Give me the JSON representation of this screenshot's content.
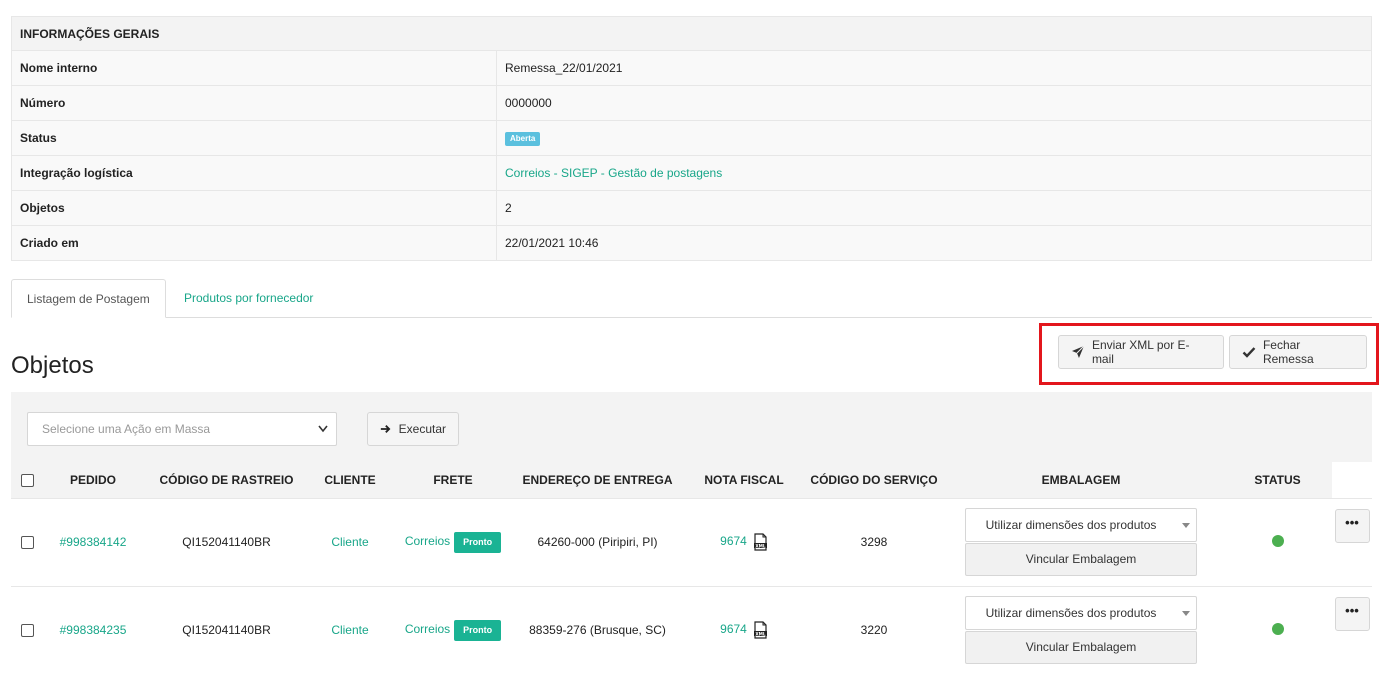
{
  "info": {
    "heading": "INFORMAÇÕES GERAIS",
    "rows": [
      {
        "label": "Nome interno",
        "value": "Remessa_22/01/2021"
      },
      {
        "label": "Número",
        "value": "0000000"
      },
      {
        "label": "Status",
        "value": "Aberta"
      },
      {
        "label": "Integração logística",
        "value": "Correios - SIGEP - Gestão de postagens"
      },
      {
        "label": "Objetos",
        "value": "2"
      },
      {
        "label": "Criado em",
        "value": "22/01/2021 10:46"
      }
    ]
  },
  "tabs": [
    {
      "label": "Listagem de Postagem"
    },
    {
      "label": "Produtos por fornecedor"
    }
  ],
  "section_title": "Objetos",
  "actions": {
    "send_xml": "Enviar XML por E-mail",
    "close_batch": "Fechar Remessa"
  },
  "bulk": {
    "select_placeholder": "Selecione uma Ação em Massa",
    "execute": "Executar"
  },
  "columns": [
    "PEDIDO",
    "CÓDIGO DE RASTREIO",
    "CLIENTE",
    "FRETE",
    "ENDEREÇO DE ENTREGA",
    "NOTA FISCAL",
    "CÓDIGO DO SERVIÇO",
    "EMBALAGEM",
    "STATUS"
  ],
  "rows": [
    {
      "pedido": "#998384142",
      "rastreio": "QI152041140BR",
      "cliente": "Cliente",
      "frete": "Correios",
      "frete_status": "Pronto",
      "endereco": "64260-000 (Piripiri, PI)",
      "nota": "9674",
      "servico": "3298",
      "embalagem": "Utilizar dimensões dos produtos",
      "vincular": "Vincular Embalagem"
    },
    {
      "pedido": "#998384235",
      "rastreio": "QI152041140BR",
      "cliente": "Cliente",
      "frete": "Correios",
      "frete_status": "Pronto",
      "endereco": "88359-276 (Brusque, SC)",
      "nota": "9674",
      "servico": "3220",
      "embalagem": "Utilizar dimensões dos produtos",
      "vincular": "Vincular Embalagem"
    }
  ],
  "more_label": "•••",
  "colors": {
    "accent": "#18a689",
    "status_ok": "#4caf50",
    "highlight": "#e3161c"
  }
}
